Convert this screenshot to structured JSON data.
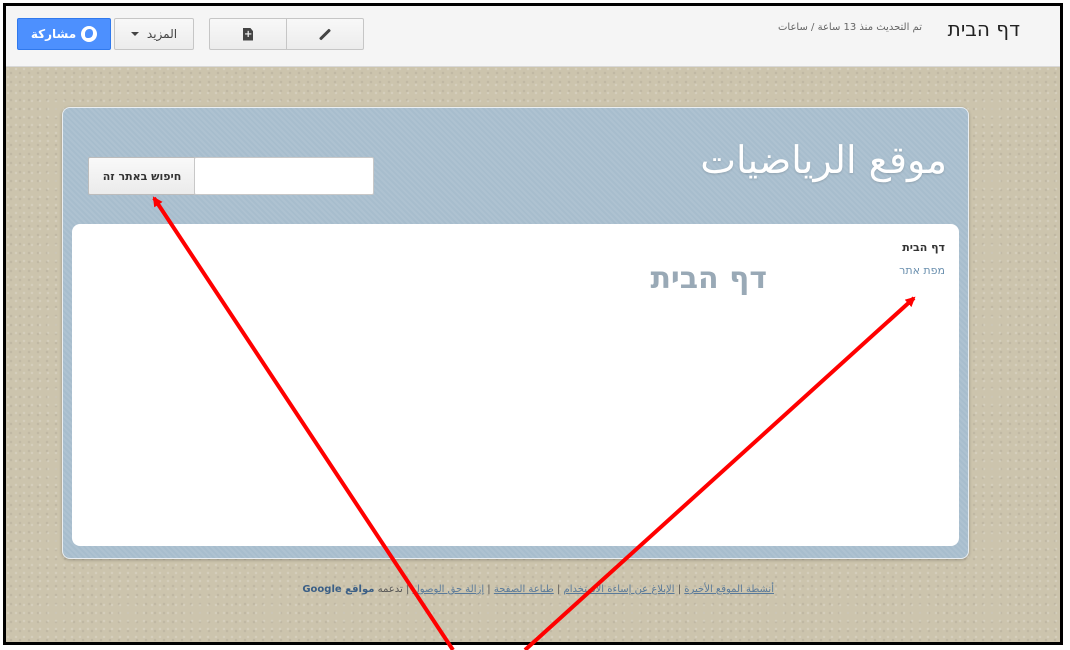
{
  "toolbar": {
    "share_label": "مشاركة",
    "more_label": "المزيد",
    "page_title": "דף הבית",
    "updated_text": "تم التحديث منذ 13 ساعة / ساعات"
  },
  "site": {
    "title": "موقع الرياضيات",
    "search_button_label": "חיפוש באתר זה",
    "search_value": ""
  },
  "nav": {
    "items": [
      {
        "label": "דף הבית"
      },
      {
        "label": "מפת אתר"
      }
    ]
  },
  "main": {
    "heading": "דף הבית"
  },
  "footer": {
    "links": [
      "أنشطة الموقع الأخيرة",
      "الإبلاغ عن إساءة الاستخدام",
      "طباعة الصفحة",
      "إزالة حق الوصول"
    ],
    "powered_by": "تدعمه",
    "brand": "مواقع Google"
  },
  "colors": {
    "share_blue": "#4d90fe",
    "panel_blue": "#a7bdcd",
    "backdrop_tan": "#ccc4ad",
    "arrow_red": "#ff0000"
  }
}
